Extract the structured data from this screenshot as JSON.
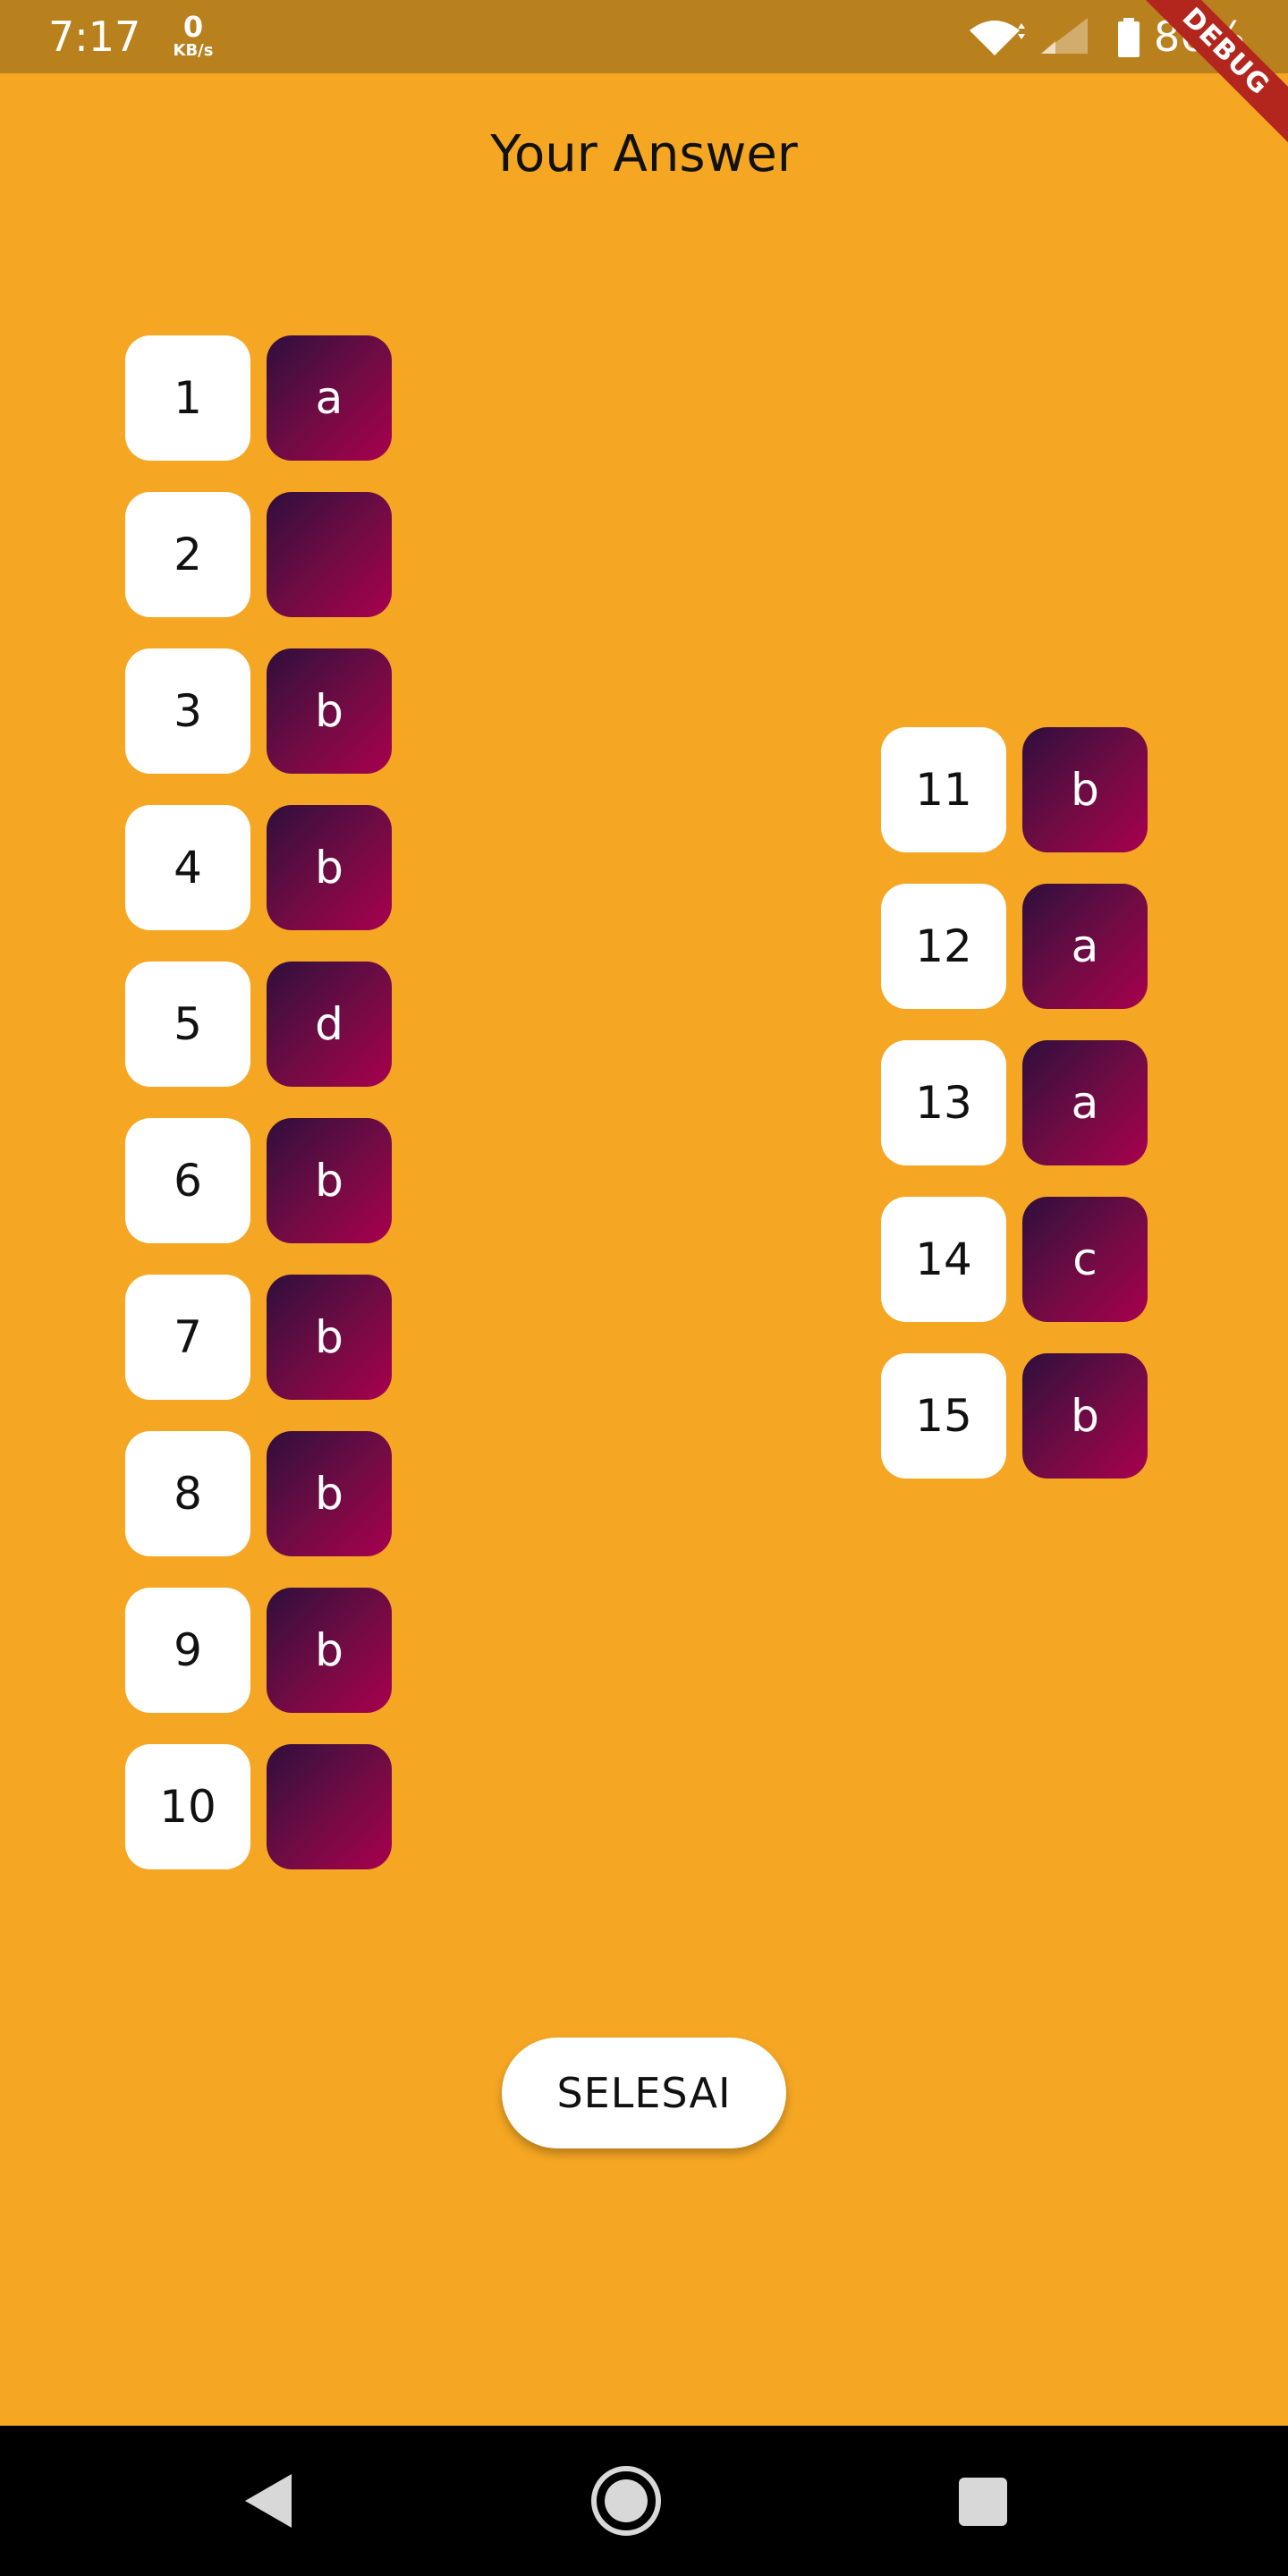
{
  "status_bar": {
    "time": "7:17",
    "net_speed_value": "0",
    "net_speed_unit": "KB/s",
    "battery_percent": "86%",
    "icons": [
      "wifi-icon",
      "signal-icon",
      "battery-icon"
    ],
    "debug_label": "DEBUG"
  },
  "title": "Your Answer",
  "answers_left": [
    {
      "number": "1",
      "answer": "a"
    },
    {
      "number": "2",
      "answer": ""
    },
    {
      "number": "3",
      "answer": "b"
    },
    {
      "number": "4",
      "answer": "b"
    },
    {
      "number": "5",
      "answer": "d"
    },
    {
      "number": "6",
      "answer": "b"
    },
    {
      "number": "7",
      "answer": "b"
    },
    {
      "number": "8",
      "answer": "b"
    },
    {
      "number": "9",
      "answer": "b"
    },
    {
      "number": "10",
      "answer": ""
    }
  ],
  "answers_right": [
    {
      "number": "11",
      "answer": "b"
    },
    {
      "number": "12",
      "answer": "a"
    },
    {
      "number": "13",
      "answer": "a"
    },
    {
      "number": "14",
      "answer": "c"
    },
    {
      "number": "15",
      "answer": "b"
    }
  ],
  "finish_button_label": "SELESAI",
  "nav_bar": {
    "icons": [
      "back-icon",
      "home-icon",
      "recents-icon"
    ]
  },
  "colors": {
    "background": "#F5A623",
    "status_bar": "#B9801E",
    "answer_gradient_start": "#2E0F3C",
    "answer_gradient_end": "#A8004E",
    "number_box": "#FFFFFF"
  }
}
